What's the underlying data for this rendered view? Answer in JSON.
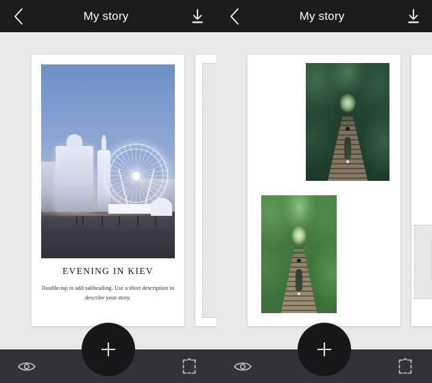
{
  "screens": [
    {
      "id": "left",
      "header": {
        "back_icon": "chevron-left-icon",
        "title": "My story",
        "download_icon": "download-icon"
      },
      "card": {
        "photo_alt": "evening-city-ferris-wheel-photo",
        "title": "EVENING IN KIEV",
        "subtitle": "Double-tap to add subheading. Use a short description to describe your story."
      },
      "placeholder": {
        "label": "empty-page-placeholder"
      },
      "bottombar": {
        "preview_icon": "eye-icon",
        "add_icon": "plus-icon",
        "crop_icon": "crop-frame-icon"
      }
    },
    {
      "id": "right",
      "header": {
        "back_icon": "chevron-left-icon",
        "title": "My story",
        "download_icon": "download-icon"
      },
      "card": {
        "photo_top_alt": "tunnel-of-love-dark-photo",
        "photo_bottom_alt": "tunnel-of-love-bright-photo"
      },
      "placeholder": {
        "label": "empty-page-placeholder"
      },
      "bottombar": {
        "preview_icon": "eye-icon",
        "add_icon": "plus-icon",
        "crop_icon": "crop-frame-icon"
      }
    }
  ],
  "colors": {
    "appbar_bg": "#1c1c1e",
    "bottombar_bg": "#31333a",
    "fab_bg": "#17171a",
    "canvas_bg": "#e9e9e9",
    "card_bg": "#ffffff",
    "icon": "#ffffff",
    "icon_muted": "#c9ccd4",
    "placeholder_fill": "#e7e7e7",
    "placeholder_border": "#c3c3c3"
  }
}
